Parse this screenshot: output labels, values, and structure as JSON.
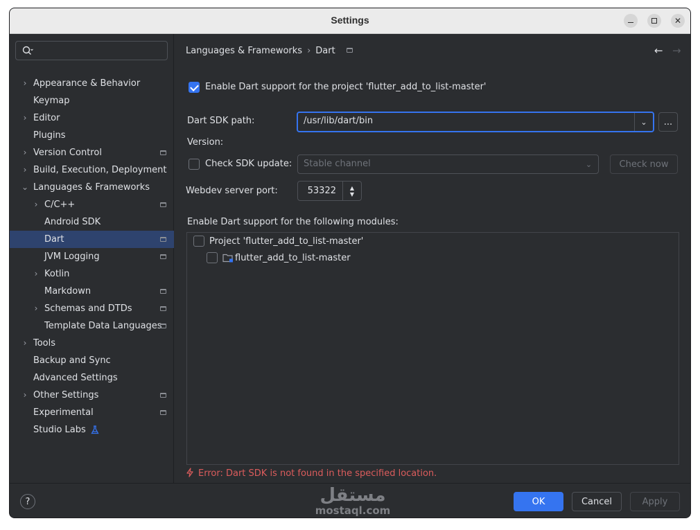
{
  "window": {
    "title": "Settings"
  },
  "search": {
    "placeholder": ""
  },
  "sidebar": {
    "items": [
      {
        "label": "Appearance & Behavior"
      },
      {
        "label": "Keymap"
      },
      {
        "label": "Editor"
      },
      {
        "label": "Plugins"
      },
      {
        "label": "Version Control"
      },
      {
        "label": "Build, Execution, Deployment"
      },
      {
        "label": "Languages & Frameworks"
      },
      {
        "label": "C/C++"
      },
      {
        "label": "Android SDK"
      },
      {
        "label": "Dart"
      },
      {
        "label": "JVM Logging"
      },
      {
        "label": "Kotlin"
      },
      {
        "label": "Markdown"
      },
      {
        "label": "Schemas and DTDs"
      },
      {
        "label": "Template Data Languages"
      },
      {
        "label": "Tools"
      },
      {
        "label": "Backup and Sync"
      },
      {
        "label": "Advanced Settings"
      },
      {
        "label": "Other Settings"
      },
      {
        "label": "Experimental"
      },
      {
        "label": "Studio Labs"
      }
    ]
  },
  "breadcrumb": {
    "parent": "Languages & Frameworks",
    "current": "Dart"
  },
  "dart": {
    "enable_label": "Enable Dart support for the project 'flutter_add_to_list-master'",
    "enable_checked": true,
    "sdk_path_label": "Dart SDK path:",
    "sdk_path_value": "/usr/lib/dart/bin",
    "browse_label": "...",
    "version_label": "Version:",
    "check_update_label": "Check SDK update:",
    "channel_value": "Stable channel",
    "check_now_label": "Check now",
    "webdev_port_label": "Webdev server port:",
    "webdev_port_value": "53322",
    "modules_heading": "Enable Dart support for the following modules:",
    "modules": [
      {
        "label": "Project 'flutter_add_to_list-master'"
      },
      {
        "label": "flutter_add_to_list-master"
      }
    ],
    "error_text": "Error: Dart SDK is not found in the specified location."
  },
  "footer": {
    "help_label": "?",
    "ok_label": "OK",
    "cancel_label": "Cancel",
    "apply_label": "Apply"
  },
  "watermark": {
    "text": "مستقل",
    "url": "mostaql.com"
  },
  "colors": {
    "accent": "#3574f0",
    "selection": "#2e436e",
    "error": "#db5c5c",
    "background": "#2b2d30"
  }
}
